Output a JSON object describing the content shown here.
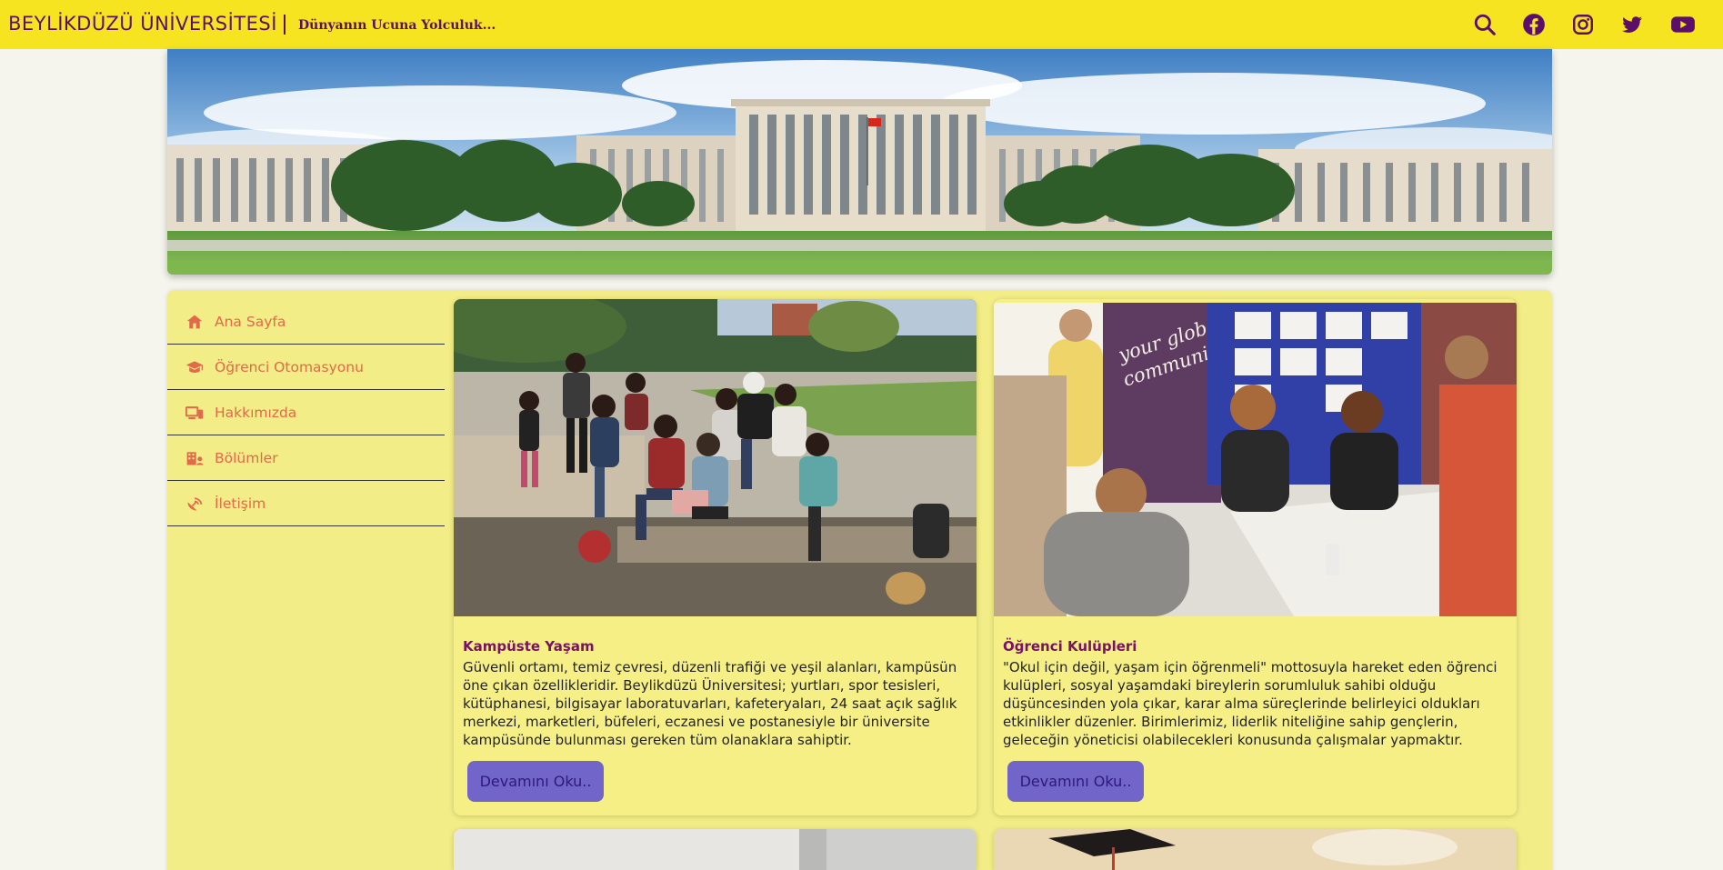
{
  "header": {
    "brand": "BEYLİKDÜZÜ ÜNİVERSİTESİ",
    "slogan": "Dünyanın Ucuna Yolculuk...",
    "icons": [
      "search-icon",
      "facebook-icon",
      "instagram-icon",
      "twitter-icon",
      "youtube-icon"
    ],
    "brand_color": "#5b0f6b",
    "bar_color": "#f5e41f"
  },
  "sidebar": {
    "items": [
      {
        "label": "Ana Sayfa",
        "icon": "home-icon"
      },
      {
        "label": "Öğrenci Otomasyonu",
        "icon": "graduation-cap-icon"
      },
      {
        "label": "Hakkımızda",
        "icon": "devices-icon"
      },
      {
        "label": "Bölümler",
        "icon": "building-user-icon"
      },
      {
        "label": "İletişim",
        "icon": "satellite-dish-icon"
      }
    ],
    "label_color": "#e06a4a"
  },
  "cards": [
    {
      "title": "Kampüste Yaşam",
      "text": "Güvenli ortamı, temiz çevresi, düzenli trafiği ve yeşil alanları, kampüsün öne çıkan özellikleridir. Beylikdüzü Üniversitesi; yurtları, spor tesisleri, kütüphanesi, bilgisayar laboratuvarları, kafeteryaları, 24 saat açık sağlık merkezi, marketleri, büfeleri, eczanesi ve postanesiyle bir üniversite kampüsünde bulunması gereken tüm olanaklara sahiptir.",
      "button": "Devamını Oku.."
    },
    {
      "title": "Öğrenci Kulüpleri",
      "text": "\"Okul için değil, yaşam için öğrenmeli\" mottosuyla hareket eden öğrenci kulüpleri, sosyal yaşamdaki bireylerin sorumluluk sahibi olduğu düşüncesinden yola çıkar, karar alma süreçlerinde belirleyici oldukları etkinlikler düzenler. Birimlerimiz, liderlik niteliğine sahip gençlerin, geleceğin yöneticisi olabilecekleri konusunda çalışmalar yapmaktır.",
      "button": "Devamını Oku..",
      "poster_text": "your global community"
    }
  ],
  "accent": "#7165c9"
}
